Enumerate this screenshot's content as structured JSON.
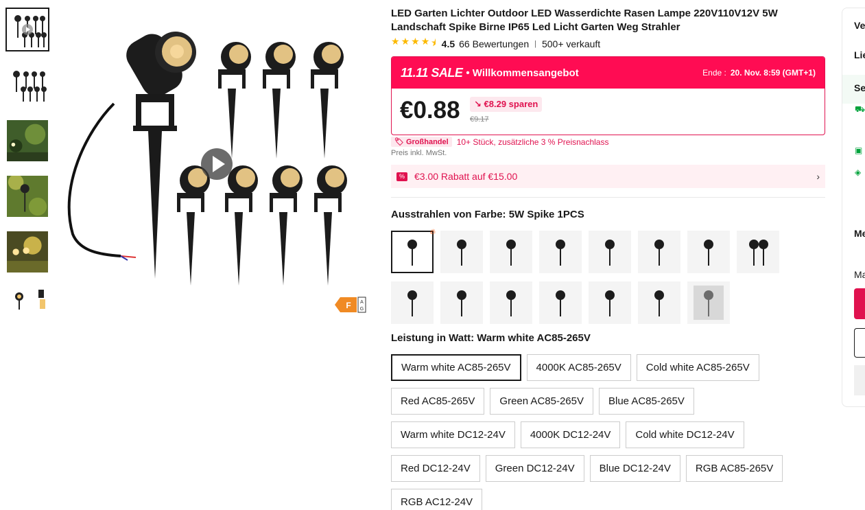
{
  "product": {
    "title": "LED Garten Lichter Outdoor LED Wasserdichte Rasen Lampe 220V110V12V 5W Landschaft Spike Birne IP65 Led Licht Garten Weg Strahler",
    "rating": "4.5",
    "reviews": "66 Bewertungen",
    "sold": "500+ verkauft"
  },
  "sale": {
    "logo": "11.11 SALE",
    "subtitle": "• Willkommensangebot",
    "end_label": "Ende :",
    "end_time": "20. Nov. 8:59 (GMT+1)",
    "price": "€0.88",
    "save": "€8.29 sparen",
    "old_price": "€9.17",
    "colors": {
      "accent": "#ff0c53"
    }
  },
  "bulk": {
    "tag": "Großhandel",
    "text": "10+ Stück, zusätzliche 3 % Preisnachlass",
    "vat": "Preis inkl. MwSt."
  },
  "coupon": {
    "icon": "%",
    "text": "€3.00 Rabatt auf €15.00"
  },
  "energy_class": {
    "letter": "F",
    "scale_top": "A",
    "scale_bottom": "G"
  },
  "color_label": "Ausstrahlen von Farbe: 5W Spike 1PCS",
  "swatches_count": 15,
  "watt_label": "Leistung in Watt: Warm white AC85-265V",
  "options": [
    "Warm white AC85-265V",
    "4000K AC85-265V",
    "Cold white AC85-265V",
    "Red AC85-265V",
    "Green AC85-265V",
    "Blue AC85-265V",
    "Warm white DC12-24V",
    "4000K DC12-24V",
    "Cold white DC12-24V",
    "Red DC12-24V",
    "Green DC12-24V",
    "Blue DC12-24V",
    "RGB AC85-265V",
    "RGB AC12-24V"
  ],
  "side": {
    "t1": "Ve",
    "t2": "Lie",
    "t3": "Se",
    "t4": "Me",
    "t5": "Ma"
  }
}
